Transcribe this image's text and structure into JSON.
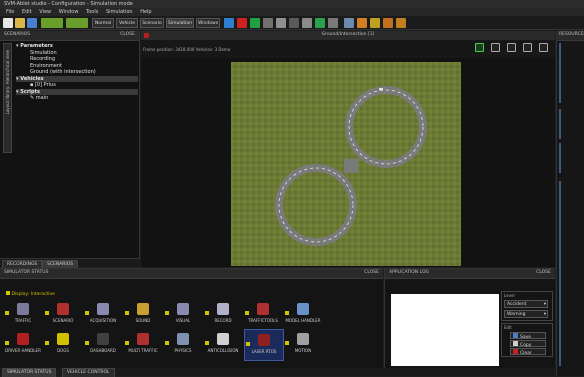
{
  "app": {
    "title": "SVM-Ablet studio - Configuration - Simulation mode"
  },
  "menu": [
    "File",
    "Edit",
    "View",
    "Window",
    "Tools",
    "Simulation",
    "Help"
  ],
  "toolbar": {
    "buttons": [
      "Normal",
      "Vehicle",
      "Scenario",
      "Simulation",
      "Windows"
    ]
  },
  "scenarios_panel": {
    "title": "SCENARIOS",
    "close": "CLOSE",
    "side_tab": "Layout library: Hierarchical view",
    "tree": {
      "parameters": "Parameters",
      "simulation": "Simulation",
      "recording": "Recording",
      "environment": "Environment",
      "ground": "Ground (with intersection)",
      "vehicles": "Vehicles",
      "vehicle_0": "[0] Prius",
      "scripts": "Scripts",
      "main": "main"
    },
    "tabs": [
      "RECORDINGS",
      "SCENARIOS"
    ]
  },
  "viewport": {
    "title": "Ground/Intersection [1]",
    "status": "Frame position: 3418.000 Vehicles: 3 Demo"
  },
  "right_panel": {
    "title": "RESOURCES"
  },
  "simulator_status": {
    "title": "SIMULATOR STATUS",
    "close": "CLOSE",
    "display_label": "Display: Interactive",
    "row1": [
      "TRAFFIC",
      "SCENARIO",
      "ACQUISITION",
      "SOUND",
      "VISUAL",
      "RECORD",
      "TRAFFICTOOLS",
      "MODEL HANDLER"
    ],
    "row2": [
      "DRIVER HANDLER",
      "DOGS",
      "DASHBOARD",
      "MULTI TRAFFIC",
      "PHYSICS",
      "ANTICOLLISION",
      "LASER RTOS",
      "MOTION"
    ],
    "colors1": [
      "#7a7a9a",
      "#b03030",
      "#8a8ab0",
      "#c8a030",
      "#8a8ab0",
      "#b0b0c8",
      "#b03030",
      "#6a90c8"
    ],
    "colors2": [
      "#b02020",
      "#d0c000",
      "#404040",
      "#b03030",
      "#8090b0",
      "#d0d0d0",
      "#902020",
      "#a0a0a0"
    ]
  },
  "app_log": {
    "title": "APPLICATION LOG",
    "close": "CLOSE",
    "level_label": "Level",
    "level1": "Accident",
    "level2": "Warning",
    "edit_label": "Edit",
    "save": "Save",
    "copy": "Copy",
    "clear": "Clear"
  },
  "bottom_tabs": [
    "SIMULATOR STATUS",
    "VEHICLE CONTROL"
  ]
}
